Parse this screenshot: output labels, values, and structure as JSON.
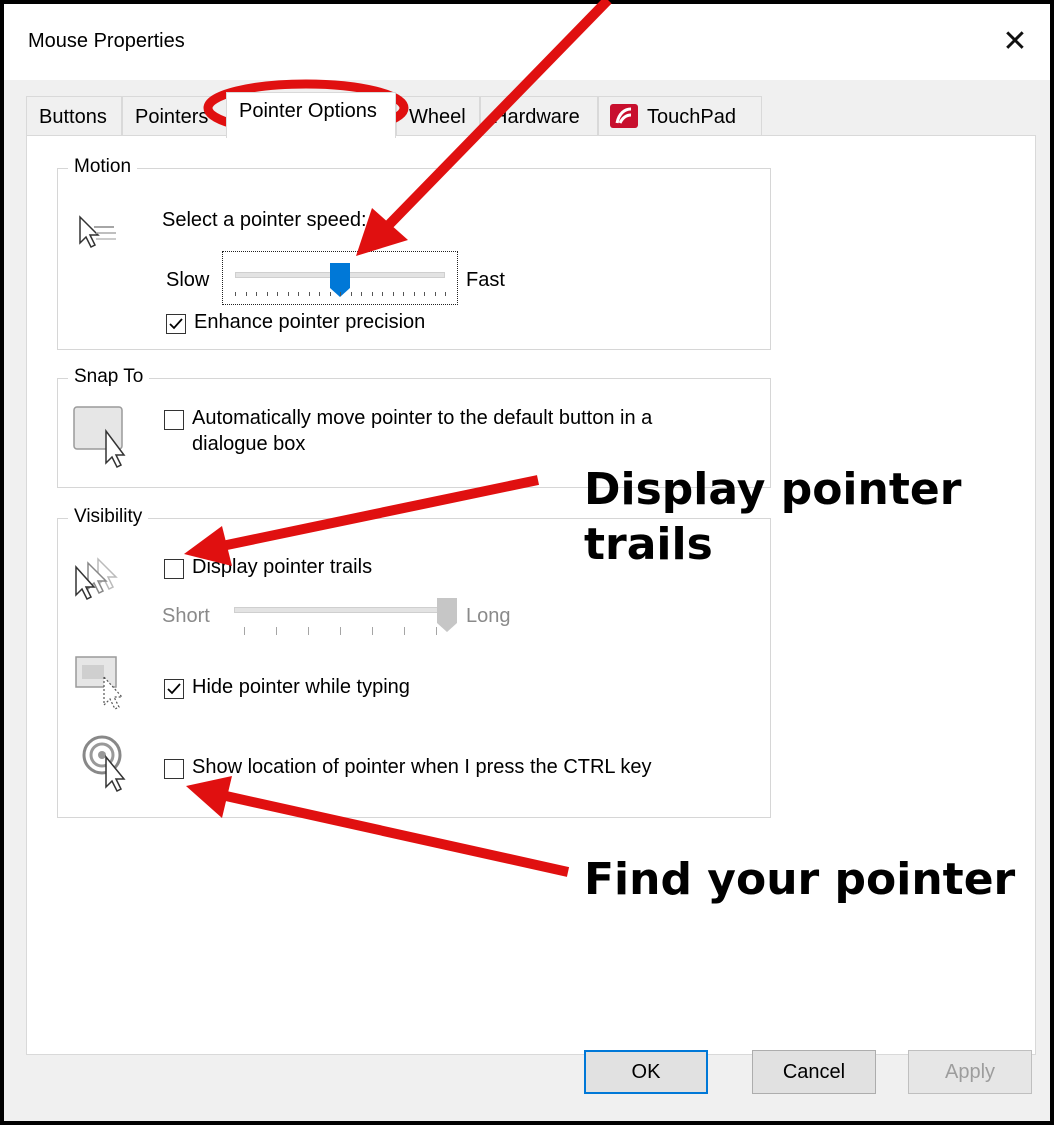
{
  "window": {
    "title": "Mouse Properties",
    "close_glyph": "✕"
  },
  "tabs": [
    {
      "label": "Buttons"
    },
    {
      "label": "Pointers"
    },
    {
      "label": "Pointer Options",
      "active": true
    },
    {
      "label": "Wheel"
    },
    {
      "label": "Hardware"
    },
    {
      "label": "TouchPad",
      "icon": "touchpad-icon"
    }
  ],
  "motion": {
    "legend": "Motion",
    "speed_label": "Select a pointer speed:",
    "slow_label": "Slow",
    "fast_label": "Fast",
    "speed_value": 0.5,
    "enhance_label": "Enhance pointer precision",
    "enhance_checked": true
  },
  "snap_to": {
    "legend": "Snap To",
    "auto_move_line1": "Automatically move pointer to the default button in a",
    "auto_move_line2": "dialogue box",
    "auto_move_checked": false
  },
  "visibility": {
    "legend": "Visibility",
    "trails_label": "Display pointer trails",
    "trails_checked": false,
    "short_label": "Short",
    "long_label": "Long",
    "trail_length_value": 1.0,
    "hide_typing_label": "Hide pointer while typing",
    "hide_typing_checked": true,
    "show_ctrl_label": "Show location of pointer when I press the CTRL key",
    "show_ctrl_checked": false
  },
  "buttons": {
    "ok": "OK",
    "cancel": "Cancel",
    "apply": "Apply"
  },
  "annotations": {
    "trails_callout_line1": "Display pointer",
    "trails_callout_line2": "trails",
    "find_callout": "Find your pointer"
  },
  "colors": {
    "accent": "#0078d7",
    "annotation": "#e01010",
    "touchpad_icon": "#c8102e"
  }
}
